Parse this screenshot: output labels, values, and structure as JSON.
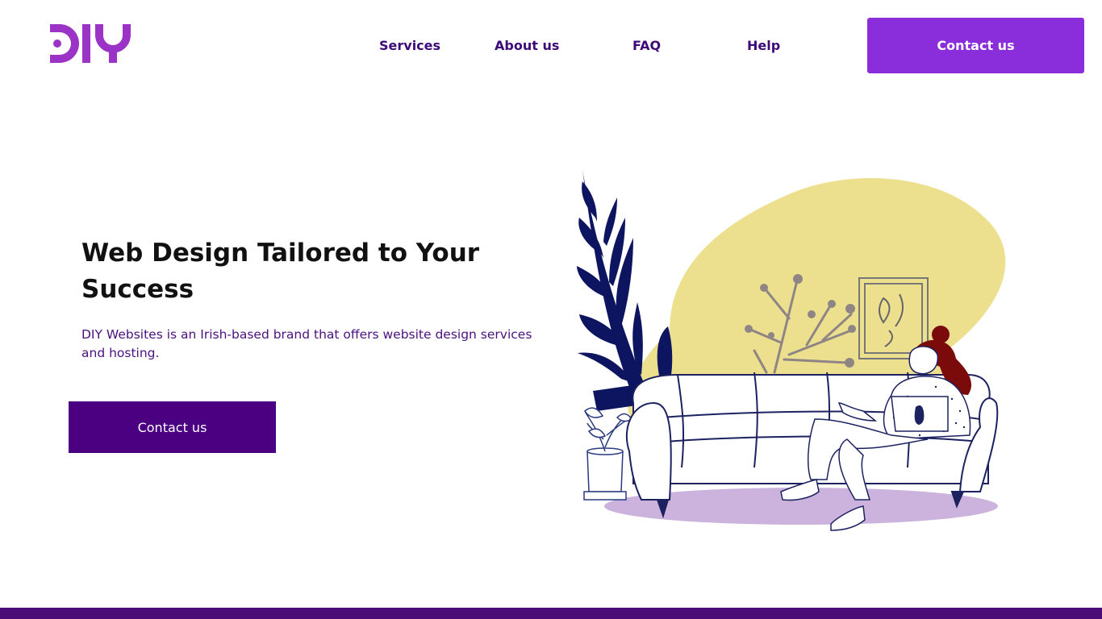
{
  "logo": {
    "text": "DIY",
    "color": "#9b33c6"
  },
  "nav": {
    "items": [
      {
        "label": "Services"
      },
      {
        "label": "About us"
      },
      {
        "label": "FAQ"
      },
      {
        "label": "Help"
      }
    ],
    "cta_label": "Contact us"
  },
  "hero": {
    "title": "Web Design Tailored to Your Success",
    "subtitle": "DIY Websites is an Irish-based brand that offers website design services and hosting.",
    "cta_label": "Contact us"
  },
  "colors": {
    "nav_text": "#3d0a78",
    "header_button": "#8a2edc",
    "hero_button": "#4b0082",
    "footer_bar": "#4a0d78",
    "blob": "#ece08f",
    "rug": "#cbb3dd",
    "plant": "#0d1460"
  },
  "illustration": {
    "name": "woman-on-sofa-with-laptop"
  }
}
